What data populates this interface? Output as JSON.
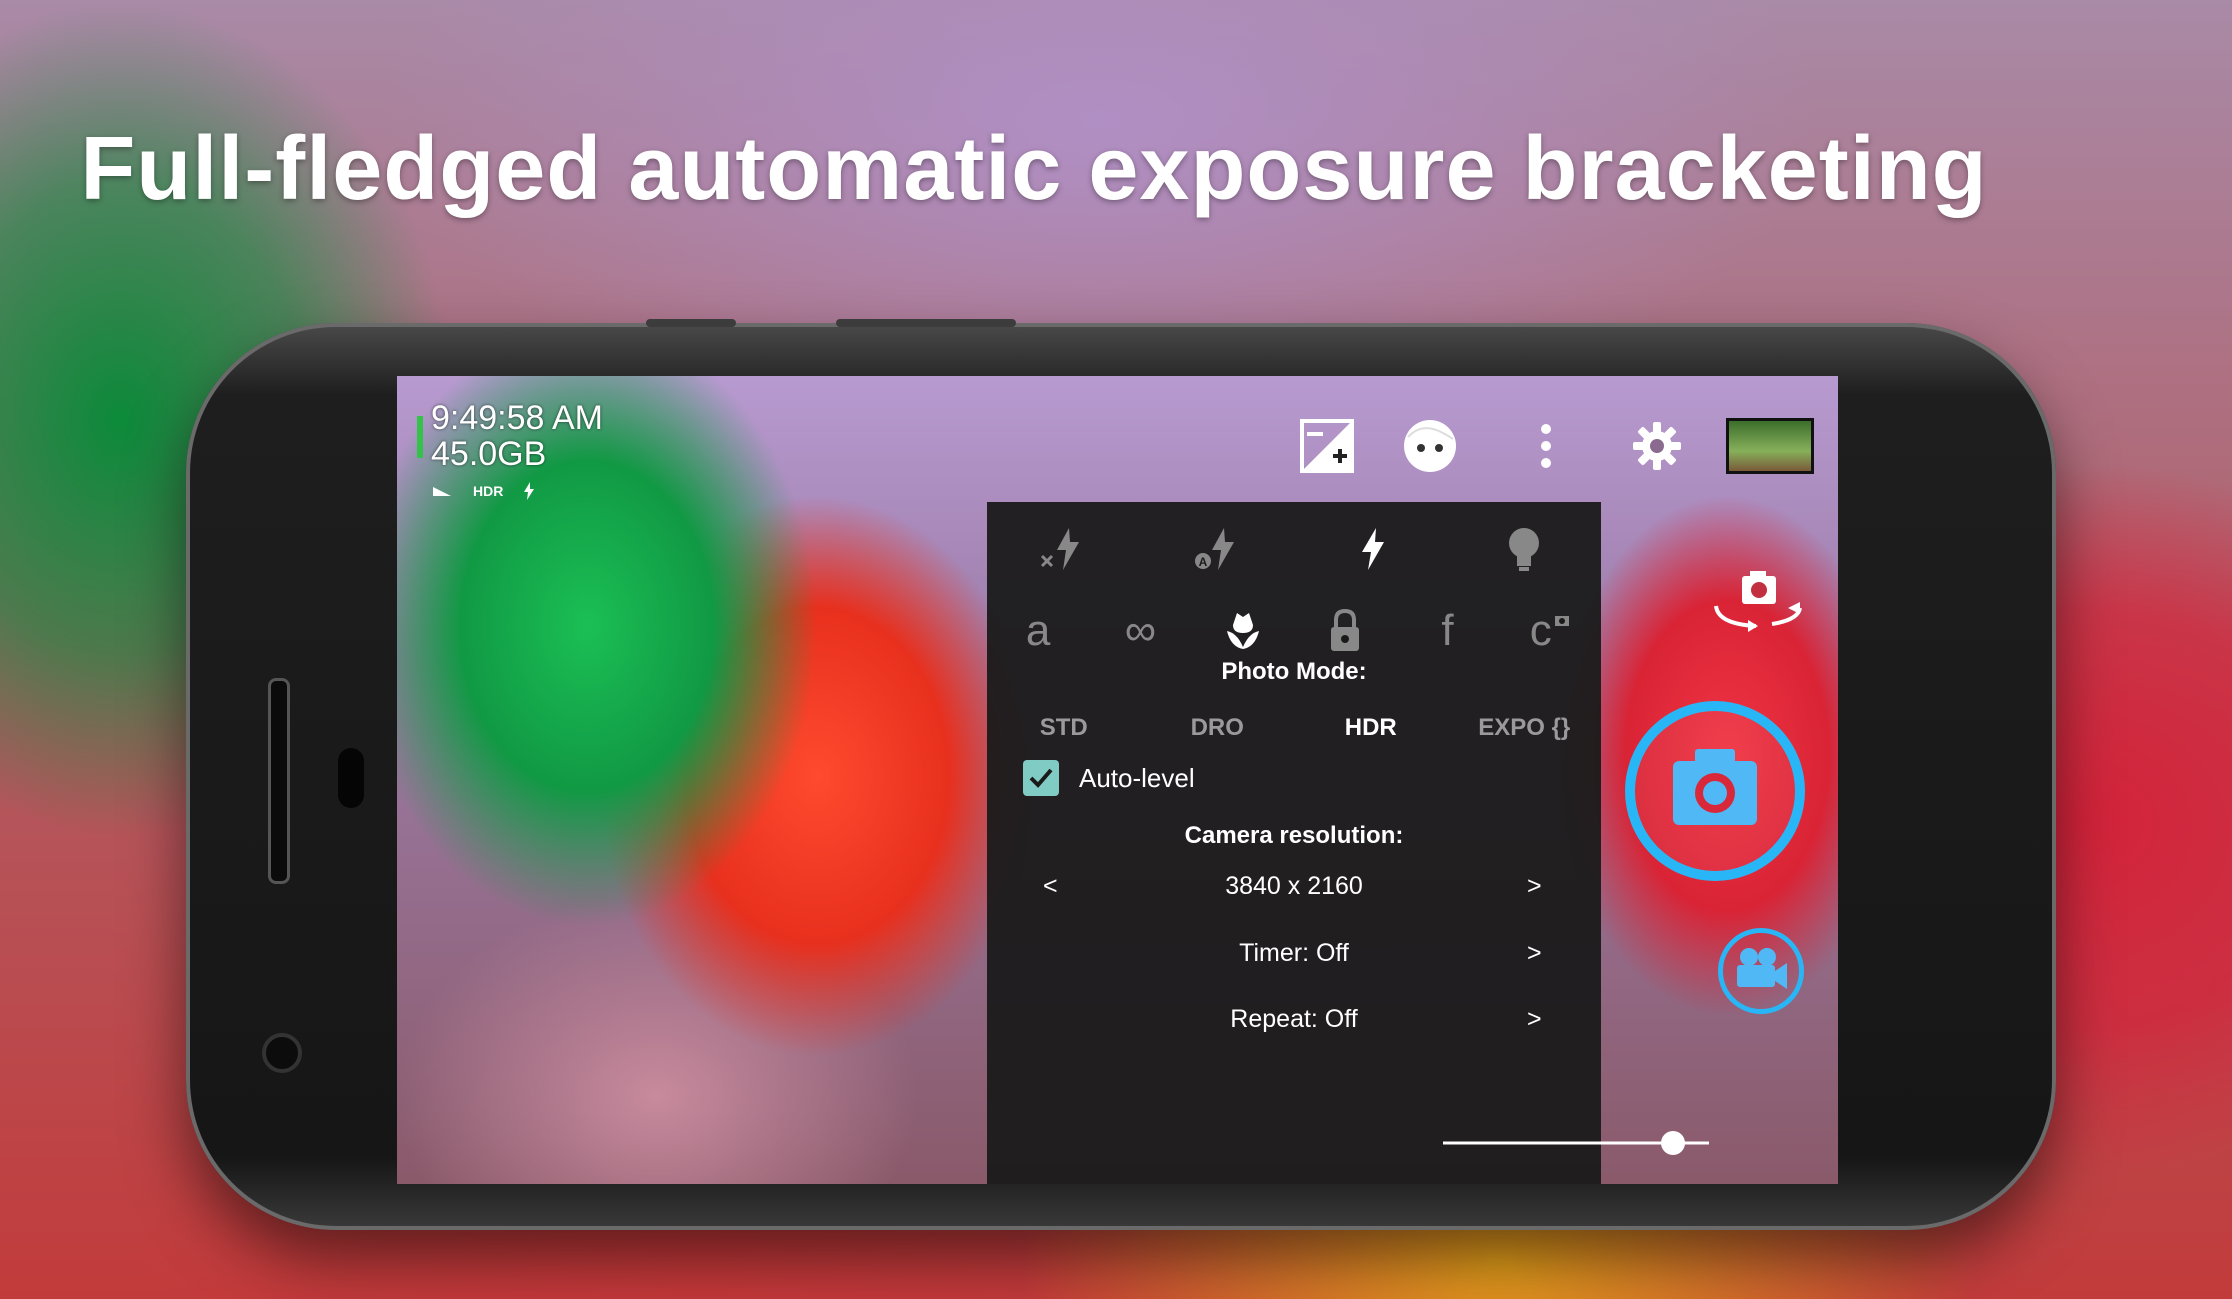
{
  "headline": "Full-fledged automatic exposure bracketing",
  "status": {
    "time": "9:49:58 AM",
    "storage": "45.0GB",
    "hdr_badge": "HDR"
  },
  "top_icons": {
    "exposure": "exposure-icon",
    "face": "face-detection-icon",
    "more": "more-vert-icon",
    "settings": "gear-icon"
  },
  "popup": {
    "flash_icons": [
      "flash-off-icon",
      "flash-auto-icon",
      "flash-on-icon",
      "torch-icon"
    ],
    "focus_icons": [
      {
        "name": "focus-auto-icon",
        "glyph": "a"
      },
      {
        "name": "focus-infinity-icon",
        "glyph": "∞"
      },
      {
        "name": "focus-macro-icon",
        "glyph": "✿"
      },
      {
        "name": "focus-locked-icon",
        "glyph": "🔒"
      },
      {
        "name": "focus-fixed-icon",
        "glyph": "f"
      },
      {
        "name": "focus-continuous-icon",
        "glyph": "c"
      }
    ],
    "photo_mode_title": "Photo Mode:",
    "modes": [
      "STD",
      "DRO",
      "HDR",
      "EXPO {}"
    ],
    "selected_mode": "HDR",
    "auto_level_label": "Auto-level",
    "auto_level_checked": true,
    "resolution_title": "Camera resolution:",
    "resolution_prev": "<",
    "resolution_value": "3840 x 2160",
    "resolution_next": ">",
    "timer_label": "Timer: Off",
    "timer_next": ">",
    "repeat_label": "Repeat: Off",
    "repeat_next": ">"
  },
  "colors": {
    "accent": "#29b6f6",
    "checkbox": "#80cbc4",
    "panel_bg": "#1a1a1a"
  },
  "controls": {
    "slider_level": 0.86
  }
}
